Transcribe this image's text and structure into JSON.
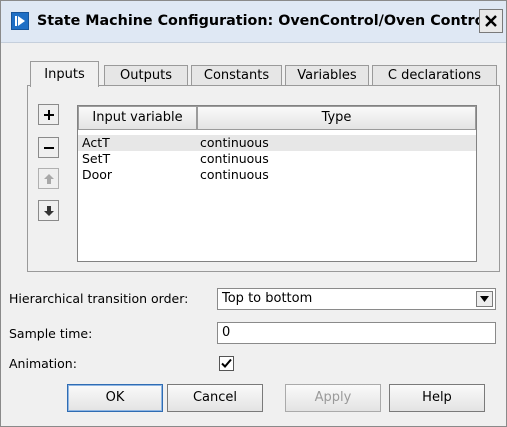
{
  "window": {
    "title": "State Machine Configuration: OvenControl/Oven Control",
    "close_symbol": "close-icon"
  },
  "tabs": [
    {
      "label": "Inputs",
      "active": true
    },
    {
      "label": "Outputs",
      "active": false
    },
    {
      "label": "Constants",
      "active": false
    },
    {
      "label": "Variables",
      "active": false
    },
    {
      "label": "C declarations",
      "active": false
    }
  ],
  "side_buttons": [
    {
      "icon": "plus-icon",
      "enabled": true
    },
    {
      "icon": "minus-icon",
      "enabled": true
    },
    {
      "icon": "arrow-up-icon",
      "enabled": false
    },
    {
      "icon": "arrow-down-icon",
      "enabled": true
    }
  ],
  "table": {
    "columns": [
      "Input variable",
      "Type"
    ],
    "rows": [
      {
        "name": "ActT",
        "type": "continuous",
        "selected": true
      },
      {
        "name": "SetT",
        "type": "continuous",
        "selected": false
      },
      {
        "name": "Door",
        "type": "continuous",
        "selected": false
      }
    ]
  },
  "settings": {
    "transition_order_label": "Hierarchical transition order:",
    "transition_order_value": "Top to bottom",
    "sample_time_label": "Sample time:",
    "sample_time_value": "0",
    "animation_label": "Animation:",
    "animation_checked": true
  },
  "buttons": {
    "ok": "OK",
    "cancel": "Cancel",
    "apply": "Apply",
    "help": "Help"
  },
  "colors": {
    "titlebar": "#dfe8f4",
    "app_icon": "#1f6fc5",
    "dialog_bg": "#f0f0f0",
    "selected_row": "#e7e7e7"
  }
}
